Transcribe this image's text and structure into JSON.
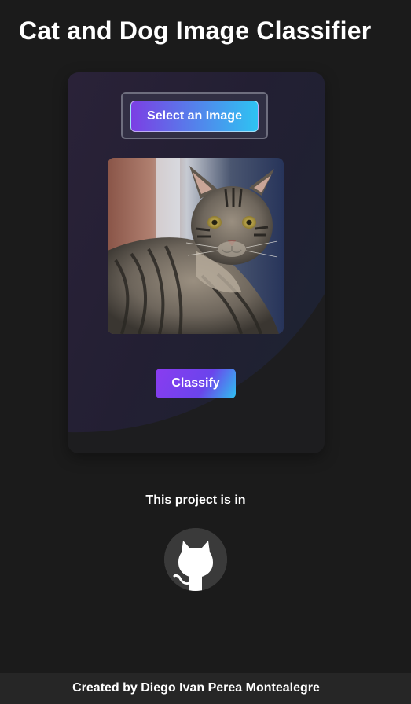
{
  "header": {
    "title": "Cat and Dog Image Classifier"
  },
  "card": {
    "select_label": "Select an Image",
    "classify_label": "Classify",
    "preview_subject": "tabby-cat-photo"
  },
  "project": {
    "text": "This project is in",
    "link_icon": "github-icon"
  },
  "footer": {
    "credit": "Created by  Diego Ivan Perea Montealegre"
  },
  "colors": {
    "page_background": "#1b1b1b",
    "card_background": "#1d1d1f",
    "card_gradient_top": "#262038",
    "button_gradient_start": "#7b3fe4",
    "button_gradient_end": "#2ec3f2",
    "footer_background": "#262626"
  }
}
